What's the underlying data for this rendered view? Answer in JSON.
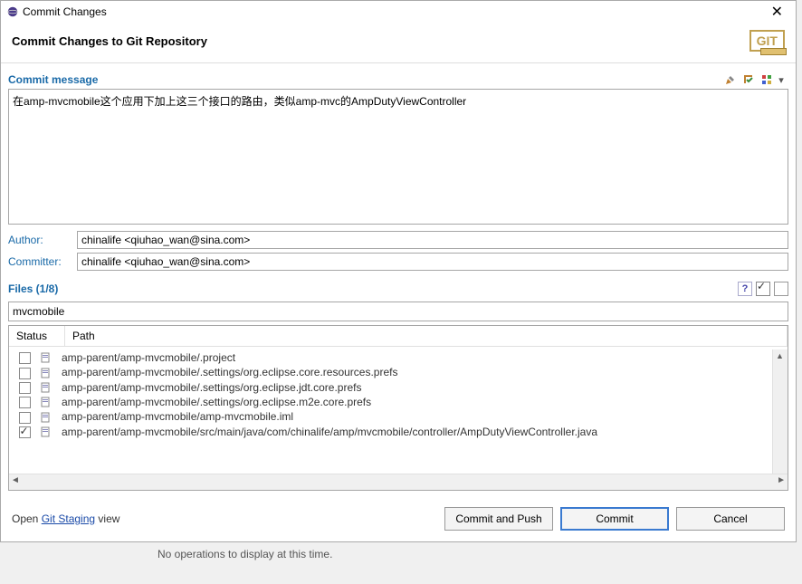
{
  "window": {
    "title": "Commit Changes"
  },
  "header": {
    "title": "Commit Changes to Git Repository",
    "badge": "GIT"
  },
  "commit_msg": {
    "label": "Commit message",
    "value": "在amp-mvcmobile这个应用下加上这三个接口的路由，类似amp-mvc的AmpDutyViewController"
  },
  "author": {
    "label": "Author:",
    "value": "chinalife <qiuhao_wan@sina.com>"
  },
  "committer": {
    "label": "Committer:",
    "value": "chinalife <qiuhao_wan@sina.com>"
  },
  "files": {
    "label": "Files (1/8)",
    "filter": "mvcmobile",
    "columns": {
      "status": "Status",
      "path": "Path"
    },
    "rows": [
      {
        "checked": false,
        "path": "amp-parent/amp-mvcmobile/.project"
      },
      {
        "checked": false,
        "path": "amp-parent/amp-mvcmobile/.settings/org.eclipse.core.resources.prefs"
      },
      {
        "checked": false,
        "path": "amp-parent/amp-mvcmobile/.settings/org.eclipse.jdt.core.prefs"
      },
      {
        "checked": false,
        "path": "amp-parent/amp-mvcmobile/.settings/org.eclipse.m2e.core.prefs"
      },
      {
        "checked": false,
        "path": "amp-parent/amp-mvcmobile/amp-mvcmobile.iml"
      },
      {
        "checked": true,
        "path": "amp-parent/amp-mvcmobile/src/main/java/com/chinalife/amp/mvcmobile/controller/AmpDutyViewController.java"
      }
    ]
  },
  "footer": {
    "open_pre": "Open ",
    "open_link": "Git Staging",
    "open_post": " view",
    "commit_push": "Commit and Push",
    "commit": "Commit",
    "cancel": "Cancel"
  },
  "background_text": "No operations to display at this time."
}
